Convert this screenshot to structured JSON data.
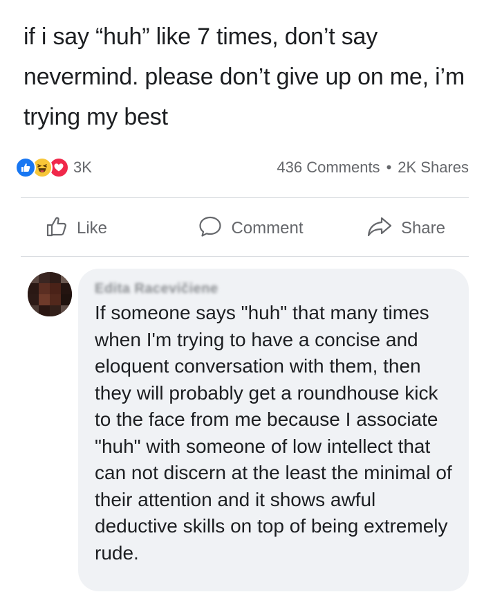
{
  "post": {
    "text": "if i say “huh” like 7 times, don’t say nevermind. please don’t give up on me, i’m trying my best"
  },
  "stats": {
    "reaction_icons": [
      "like-icon",
      "haha-icon",
      "love-icon"
    ],
    "reaction_count": "3K",
    "comments": "436 Comments",
    "separator": "•",
    "shares": "2K Shares"
  },
  "actions": {
    "like_label": "Like",
    "comment_label": "Comment",
    "share_label": "Share"
  },
  "comment": {
    "author": "Edita Racevičiene",
    "text": "If someone says \"huh\" that many times when I'm trying to have a concise and eloquent conversation with them, then they will probably get a roundhouse kick to the face from me because I associate \"huh\" with someone of low intellect that can not discern at the least the minimal of their attention and it shows awful deductive skills on top of being extremely rude."
  },
  "colors": {
    "like_blue": "#1877f2",
    "haha_yellow": "#f7c638",
    "love_red": "#f0284a",
    "secondary_text": "#65676b",
    "bubble_bg": "#f0f2f5"
  }
}
